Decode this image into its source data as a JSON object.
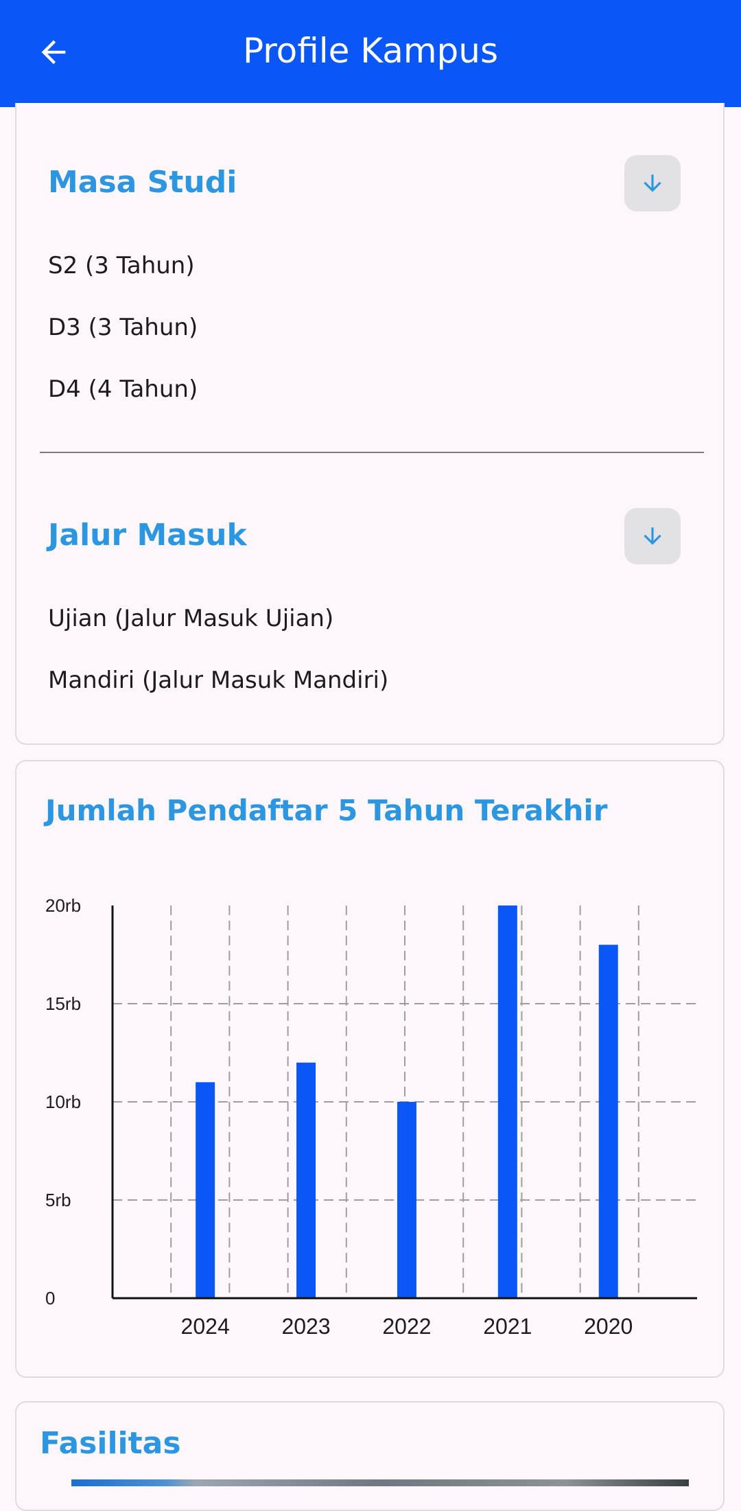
{
  "appbar": {
    "title": "Profile Kampus",
    "back_icon": "arrow-left-icon",
    "color": "#0a57f5"
  },
  "masa_studi": {
    "title": "Masa Studi",
    "toggle_icon": "arrow-down-icon",
    "items": [
      "S2 (3 Tahun)",
      "D3 (3 Tahun)",
      "D4 (4 Tahun)"
    ]
  },
  "jalur_masuk": {
    "title": "Jalur Masuk",
    "toggle_icon": "arrow-down-icon",
    "items": [
      "Ujian (Jalur Masuk Ujian)",
      "Mandiri (Jalur Masuk Mandiri)"
    ]
  },
  "chart_section": {
    "title": "Jumlah Pendaftar 5 Tahun Terakhir"
  },
  "chart_data": {
    "type": "bar",
    "categories": [
      "2024",
      "2023",
      "2022",
      "2021",
      "2020"
    ],
    "values": [
      11000,
      12000,
      10000,
      20000,
      18000
    ],
    "ylim": [
      0,
      20000
    ],
    "yticks": [
      0,
      5000,
      10000,
      15000,
      20000
    ],
    "ytick_labels": [
      "0",
      "5rb",
      "10rb",
      "15rb",
      "20rb"
    ],
    "bar_color": "#0a57f5",
    "grid": true,
    "title": "",
    "xlabel": "",
    "ylabel": ""
  },
  "fasilitas": {
    "title": "Fasilitas"
  },
  "colors": {
    "accent": "#2d96e0",
    "background": "#fdf7fc"
  }
}
